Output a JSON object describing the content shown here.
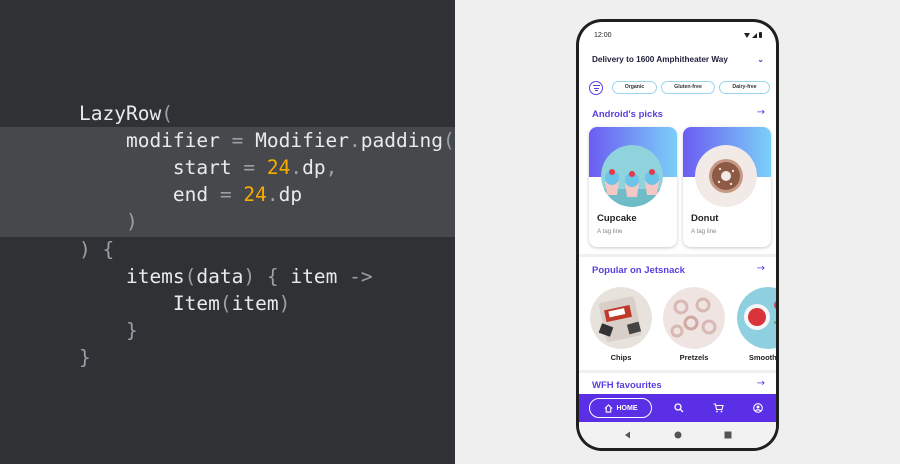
{
  "code": {
    "lines": [
      [
        {
          "t": "LazyRow"
        },
        {
          "t": "(",
          "c": "punct"
        }
      ],
      [
        {
          "t": "    modifier "
        },
        {
          "t": "=",
          "c": "punct"
        },
        {
          "t": " Modifier"
        },
        {
          "t": ".",
          "c": "punct"
        },
        {
          "t": "padding"
        },
        {
          "t": "(",
          "c": "punct"
        }
      ],
      [
        {
          "t": "        start "
        },
        {
          "t": "=",
          "c": "punct"
        },
        {
          "t": " "
        },
        {
          "t": "24",
          "c": "num"
        },
        {
          "t": ".",
          "c": "punct"
        },
        {
          "t": "dp"
        },
        {
          "t": ",",
          "c": "punct"
        }
      ],
      [
        {
          "t": "        end "
        },
        {
          "t": "=",
          "c": "punct"
        },
        {
          "t": " "
        },
        {
          "t": "24",
          "c": "num"
        },
        {
          "t": ".",
          "c": "punct"
        },
        {
          "t": "dp"
        }
      ],
      [
        {
          "t": "    "
        },
        {
          "t": ")",
          "c": "punct"
        }
      ],
      [
        {
          "t": ") {",
          "c": "punct"
        }
      ],
      [
        {
          "t": "    items"
        },
        {
          "t": "(",
          "c": "punct"
        },
        {
          "t": "data"
        },
        {
          "t": ")",
          "c": "punct"
        },
        {
          "t": " "
        },
        {
          "t": "{",
          "c": "punct"
        },
        {
          "t": " item "
        },
        {
          "t": "->",
          "c": "punct"
        }
      ],
      [
        {
          "t": "        Item"
        },
        {
          "t": "(",
          "c": "punct"
        },
        {
          "t": "item"
        },
        {
          "t": ")",
          "c": "punct"
        }
      ],
      [
        {
          "t": "    "
        },
        {
          "t": "}",
          "c": "punct"
        }
      ],
      [
        {
          "t": "}",
          "c": "punct"
        }
      ]
    ]
  },
  "phone": {
    "status_time": "12:00",
    "delivery_text": "Delivery to 1600 Amphitheater Way",
    "filters": [
      "Organic",
      "Gluten-free",
      "Dairy-free"
    ],
    "sections": {
      "picks_title": "Android's picks",
      "popular_title": "Popular on Jetsnack",
      "wfh_title": "WFH favourites"
    },
    "picks": [
      {
        "name": "Cupcake",
        "tagline": "A tag line"
      },
      {
        "name": "Donut",
        "tagline": "A tag line"
      }
    ],
    "popular": [
      {
        "name": "Chips"
      },
      {
        "name": "Pretzels"
      },
      {
        "name": "Smoothies"
      }
    ],
    "nav": {
      "home_label": "HOME"
    },
    "colors": {
      "accent": "#5b3ee0",
      "nav_background": "#5b2fe6",
      "card_gradient_start": "#6c5cf2",
      "card_gradient_end": "#7ad0f8",
      "chip_border": "#9ad4ee",
      "code_number": "#f9ab00"
    },
    "icons": [
      "filter-icon",
      "chevron-down-icon",
      "arrow-right-icon",
      "home-icon",
      "search-icon",
      "cart-icon",
      "profile-icon",
      "back-icon",
      "home-gesture-icon",
      "recents-icon"
    ]
  }
}
